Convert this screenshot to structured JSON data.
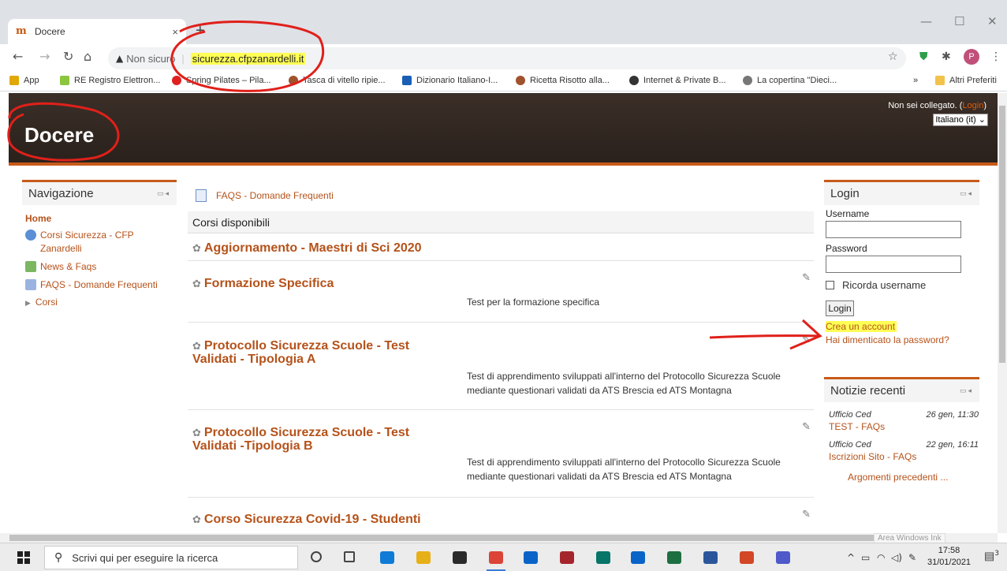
{
  "browser": {
    "tab_title": "Docere",
    "tab_favicon": "m",
    "tab_close": "×",
    "new_tab": "+",
    "url_security": "Non sicuro",
    "url": "sicurezza.cfpzanardelli.it",
    "avatar_letter": "P",
    "bookmarks": [
      {
        "label": "App",
        "color": "#e0a800"
      },
      {
        "label": "RE Registro Elettron...",
        "color": "#8cc63f"
      },
      {
        "label": "Spring Pilates – Pila...",
        "color": "#e02020"
      },
      {
        "label": "Tasca di vitello ripie...",
        "color": "#a0522d"
      },
      {
        "label": "Dizionario Italiano-I...",
        "color": "#1a5fb4"
      },
      {
        "label": "Ricetta Risotto alla...",
        "color": "#a0522d"
      },
      {
        "label": "Internet & Private B...",
        "color": "#333333"
      },
      {
        "label": "La copertina \"Dieci...",
        "color": "#777777"
      }
    ],
    "more_bookmarks": "»",
    "other_bookmarks": "Altri Preferiti"
  },
  "header": {
    "site_title": "Docere",
    "login_status": "Non sei collegato. (",
    "login_link": "Login",
    "login_close": ")",
    "language": "Italiano (it)"
  },
  "navigation": {
    "title": "Navigazione",
    "home": "Home",
    "items": [
      {
        "label": "Corsi Sicurezza - CFP Zanardelli",
        "icon_color": "#5b8fd6"
      },
      {
        "label": "News & Faqs",
        "icon_color": "#7bb661"
      },
      {
        "label": "FAQS - Domande Frequenti",
        "icon_color": "#9bb3e0"
      }
    ],
    "corsi": "Corsi"
  },
  "main": {
    "faq_link": "FAQS - Domande Frequenti",
    "available_heading": "Corsi disponibili",
    "courses": [
      {
        "title": "Aggiornamento - Maestri di Sci 2020",
        "description": ""
      },
      {
        "title": "Formazione Specifica",
        "description": "Test per la formazione specifica"
      },
      {
        "title": "Protocollo Sicurezza Scuole - Test Validati - Tipologia A",
        "description": "Test di apprendimento sviluppati all'interno del Protocollo Sicurezza Scuole mediante questionari validati da ATS Brescia ed ATS Montagna"
      },
      {
        "title": "Protocollo Sicurezza Scuole - Test Validati -Tipologia B",
        "description": "Test di apprendimento sviluppati all'interno del Protocollo Sicurezza Scuole mediante questionari validati da ATS Brescia ed ATS Montagna"
      },
      {
        "title": "Corso Sicurezza Covid-19 - Studenti",
        "description": ""
      }
    ]
  },
  "login_block": {
    "title": "Login",
    "username_label": "Username",
    "password_label": "Password",
    "remember_label": "Ricorda username",
    "login_button": "Login",
    "create_account": "Crea un account",
    "forgot_password": "Hai dimenticato la password?"
  },
  "news_block": {
    "title": "Notizie recenti",
    "items": [
      {
        "author": "Ufficio Ced",
        "date": "26 gen, 11:30",
        "title": "TEST - FAQs"
      },
      {
        "author": "Ufficio Ced",
        "date": "22 gen, 16:11",
        "title": "Iscrizioni Sito - FAQs"
      }
    ],
    "older": "Argomenti precedenti ..."
  },
  "taskbar": {
    "search_placeholder": "Scrivi qui per eseguire la ricerca",
    "watermark": "Area Windows Ink",
    "time": "17:58",
    "date": "31/01/2021",
    "notifications": "3",
    "apps": [
      {
        "name": "cortana-icon",
        "color": "#444444"
      },
      {
        "name": "task-view-icon",
        "color": "#444444"
      },
      {
        "name": "edge-icon",
        "color": "#0f7bd7"
      },
      {
        "name": "file-explorer-icon",
        "color": "#e8b018"
      },
      {
        "name": "store-icon",
        "color": "#2a2a2a"
      },
      {
        "name": "chrome-icon",
        "color": "#db4437"
      },
      {
        "name": "mail-icon",
        "color": "#0a64c8"
      },
      {
        "name": "access-icon",
        "color": "#a4262c"
      },
      {
        "name": "publisher-icon",
        "color": "#077568"
      },
      {
        "name": "outlook-icon",
        "color": "#0a64c8"
      },
      {
        "name": "excel-icon",
        "color": "#1d6f42"
      },
      {
        "name": "word-icon",
        "color": "#2b579a"
      },
      {
        "name": "powerpoint-icon",
        "color": "#d24726"
      },
      {
        "name": "teams-icon",
        "color": "#5059c9"
      }
    ]
  },
  "colors": {
    "accent": "#b5521a",
    "header_bg": "#2f2520",
    "highlight": "#ffff55",
    "annotation": "#e0201a"
  }
}
